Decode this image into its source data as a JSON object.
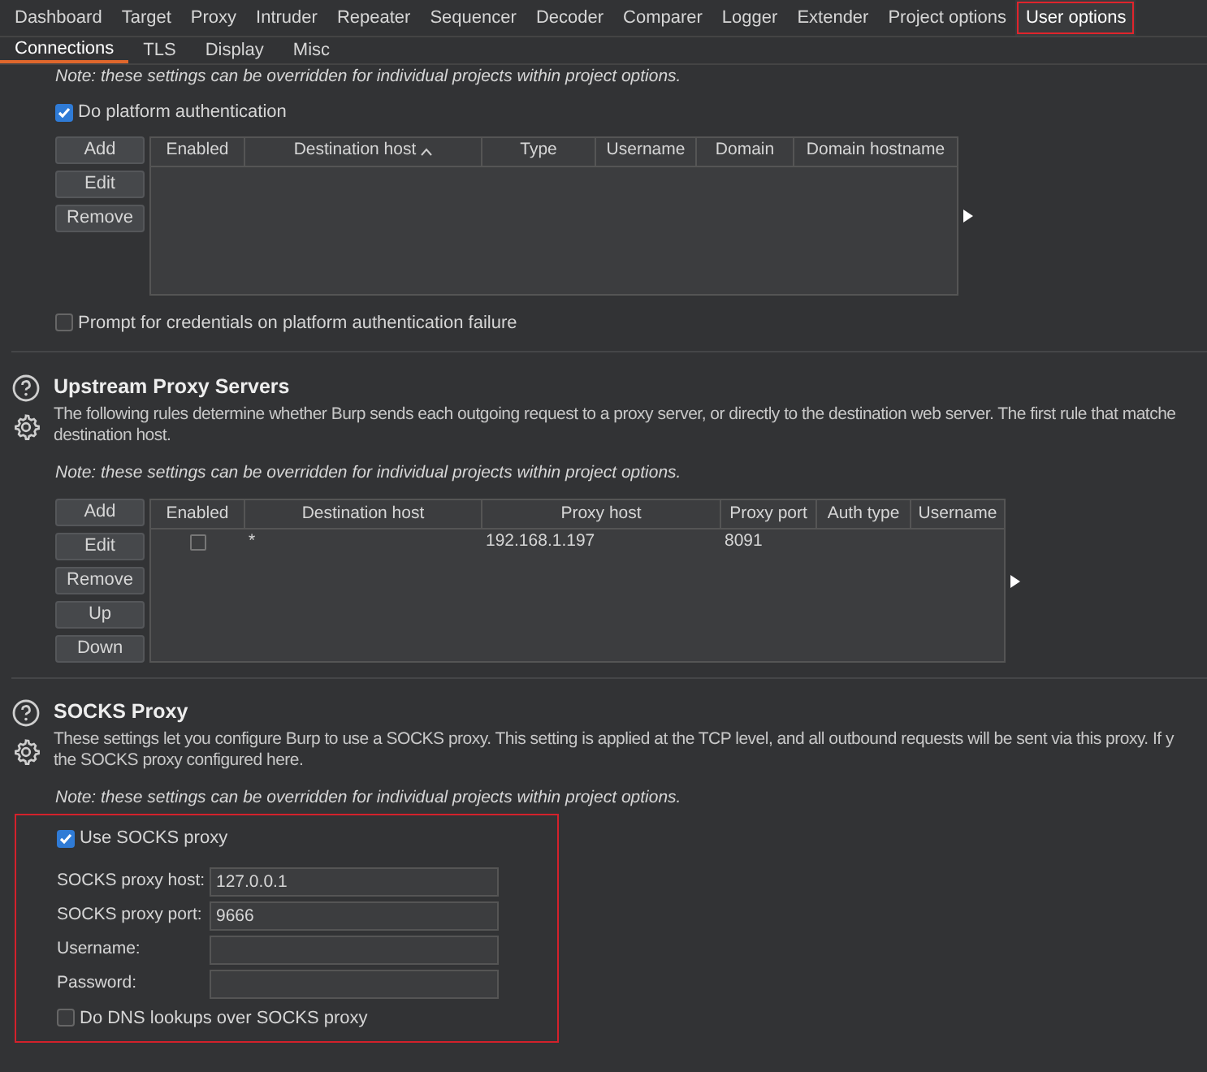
{
  "tabs": [
    {
      "label": "Dashboard",
      "selected": false,
      "highlighted": false
    },
    {
      "label": "Target",
      "selected": false,
      "highlighted": false
    },
    {
      "label": "Proxy",
      "selected": false,
      "highlighted": false
    },
    {
      "label": "Intruder",
      "selected": false,
      "highlighted": false
    },
    {
      "label": "Repeater",
      "selected": false,
      "highlighted": false
    },
    {
      "label": "Sequencer",
      "selected": false,
      "highlighted": false
    },
    {
      "label": "Decoder",
      "selected": false,
      "highlighted": false
    },
    {
      "label": "Comparer",
      "selected": false,
      "highlighted": false
    },
    {
      "label": "Logger",
      "selected": false,
      "highlighted": false
    },
    {
      "label": "Extender",
      "selected": false,
      "highlighted": false
    },
    {
      "label": "Project options",
      "selected": false,
      "highlighted": false
    },
    {
      "label": "User options",
      "selected": true,
      "highlighted": true
    }
  ],
  "subtabs": [
    {
      "label": "Connections",
      "selected": true
    },
    {
      "label": "TLS",
      "selected": false
    },
    {
      "label": "Display",
      "selected": false
    },
    {
      "label": "Misc",
      "selected": false
    }
  ],
  "platform_auth": {
    "note": "Note: these settings can be overridden for individual projects within project options.",
    "enable": {
      "label": "Do platform authentication",
      "checked": true
    },
    "buttons": [
      "Add",
      "Edit",
      "Remove"
    ],
    "columns": [
      {
        "label": "Enabled",
        "sorted": false
      },
      {
        "label": "Destination host",
        "sorted": true
      },
      {
        "label": "Type",
        "sorted": false
      },
      {
        "label": "Username",
        "sorted": false
      },
      {
        "label": "Domain",
        "sorted": false
      },
      {
        "label": "Domain hostname",
        "sorted": false
      }
    ],
    "prompt": {
      "label": "Prompt for credentials on platform authentication failure",
      "checked": false
    }
  },
  "upstream": {
    "title": "Upstream Proxy Servers",
    "description": [
      "The following rules determine whether Burp sends each outgoing request to a proxy server, or directly to the destination web server. The first rule that matche",
      "destination host."
    ],
    "note": "Note: these settings can be overridden for individual projects within project options.",
    "buttons": [
      "Add",
      "Edit",
      "Remove",
      "Up",
      "Down"
    ],
    "columns": [
      "Enabled",
      "Destination host",
      "Proxy host",
      "Proxy port",
      "Auth type",
      "Username"
    ],
    "rows": [
      {
        "enabled": false,
        "destination_host": "*",
        "proxy_host": "192.168.1.197",
        "proxy_port": "8091"
      }
    ]
  },
  "socks": {
    "title": "SOCKS Proxy",
    "description": [
      "These settings let you configure Burp to use a SOCKS proxy. This setting is applied at the TCP level, and all outbound requests will be sent via this proxy. If y",
      "the SOCKS proxy configured here."
    ],
    "note": "Note: these settings can be overridden for individual projects within project options.",
    "highlighted": true,
    "use": {
      "label": "Use SOCKS proxy",
      "checked": true
    },
    "fields": [
      {
        "label": "SOCKS proxy host:",
        "value": "127.0.0.1"
      },
      {
        "label": "SOCKS proxy port:",
        "value": "9666"
      },
      {
        "label": "Username:"
      },
      {
        "label": "Password:"
      }
    ],
    "dns": {
      "label": "Do DNS lookups over SOCKS proxy",
      "checked": false
    }
  }
}
